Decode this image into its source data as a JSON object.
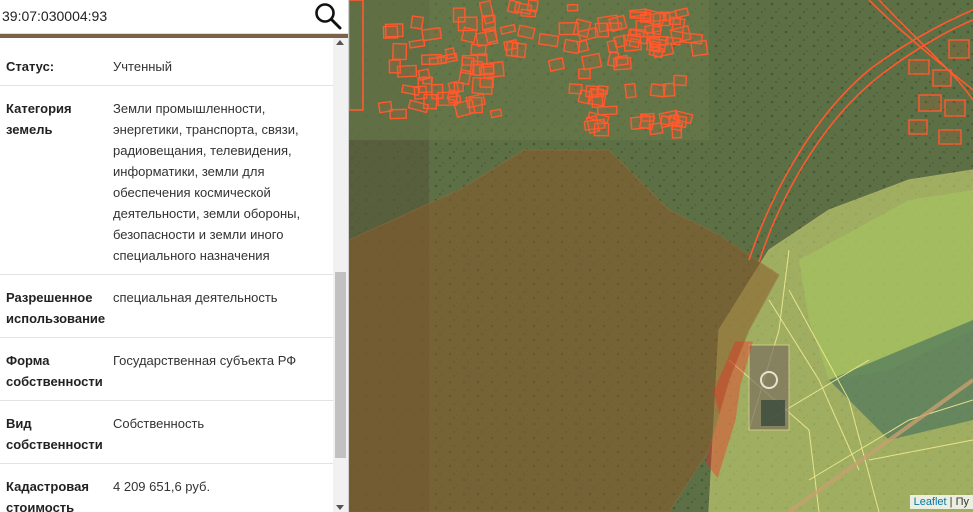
{
  "search": {
    "value": "39:07:030004:93"
  },
  "info_rows": [
    {
      "key": "Статус:",
      "value": "Учтенный"
    },
    {
      "key": "Категория земель",
      "value": "Земли промышленности, энергетики, транспорта, связи, радиовещания, телевидения, информатики, земли для обеспечения космической деятельности, земли обороны, безопасности и земли иного специального назначения"
    },
    {
      "key": "Разрешенное использование",
      "value": "специальная деятельность"
    },
    {
      "key": "Форма собственности",
      "value": "Государственная субъекта РФ"
    },
    {
      "key": "Вид собственности",
      "value": "Собственность"
    },
    {
      "key": "Кадастровая стоимость",
      "value": "4 209 651,6 руб."
    }
  ],
  "map": {
    "attribution_link": "Leaflet",
    "attribution_sep": " | ",
    "attribution_rest": "Пу"
  },
  "colors": {
    "parcel_outline": "#ff5a2e",
    "selected_parcel": "#ff1e1e",
    "large_zone_fill": "#8a5a2a",
    "agricultural_fill": "#d8e27a"
  }
}
